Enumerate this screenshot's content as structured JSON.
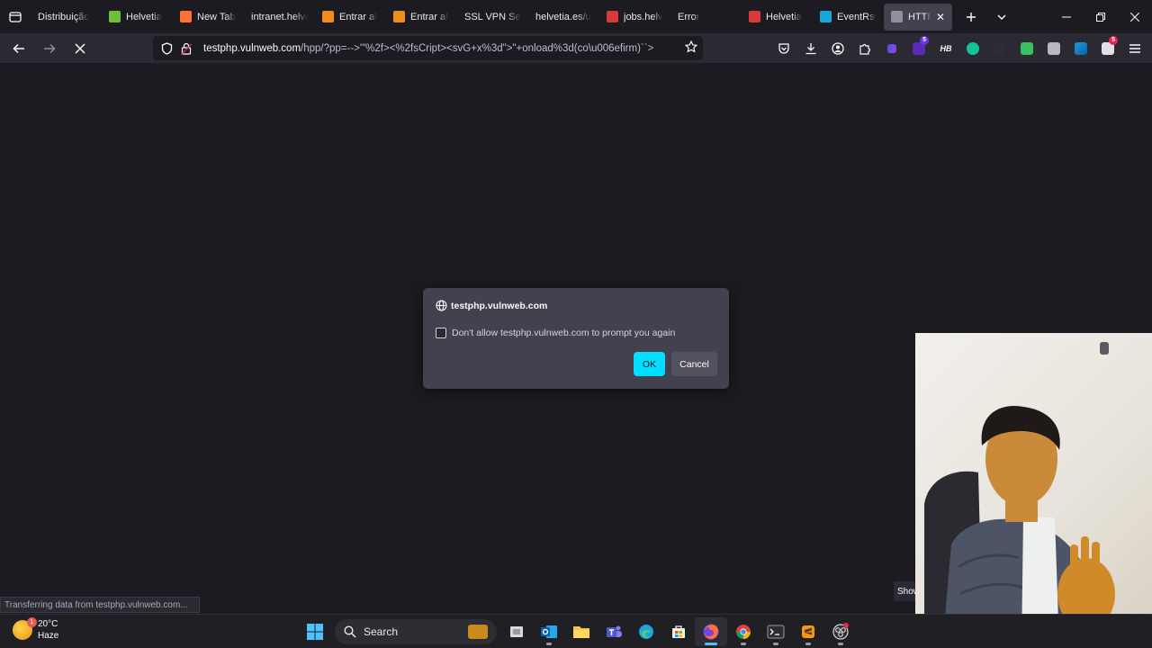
{
  "tabs": [
    {
      "label": "Distribuição",
      "color": "#1c1b22"
    },
    {
      "label": "Helvetia",
      "color": "#6bbf3a"
    },
    {
      "label": "New Tab",
      "color": "#ff7139"
    },
    {
      "label": "intranet.helve",
      "color": "#1c1b22"
    },
    {
      "label": "Entrar al",
      "color": "#f08c1b"
    },
    {
      "label": "Entrar al",
      "color": "#f08c1b"
    },
    {
      "label": "SSL VPN Serv",
      "color": "#1c1b22"
    },
    {
      "label": "helvetia.es/u",
      "color": "#1c1b22"
    },
    {
      "label": "jobs.helv",
      "color": "#d63a3a"
    },
    {
      "label": "Error",
      "color": "#1c1b22"
    },
    {
      "label": "Helvetia",
      "color": "#d63a3a"
    },
    {
      "label": "EventRsv",
      "color": "#1ba6d8"
    },
    {
      "label": "HTTP",
      "color": "#8f8f9d",
      "active": true
    }
  ],
  "urlbar": {
    "host": "testphp.vulnweb.com",
    "path": "/hpp/?pp=-->'\"%2f><%2fsCript><svG+x%3d\">\"+onload%3d(co\\u006efirm)``>"
  },
  "dialog": {
    "origin": "testphp.vulnweb.com",
    "checkbox_label": "Don't allow testphp.vulnweb.com to prompt you again",
    "ok_label": "OK",
    "cancel_label": "Cancel"
  },
  "status": "Transferring data from testphp.vulnweb.com...",
  "show_label": "Show",
  "extensions": {
    "badge_purple": "5",
    "badge_red": "5"
  },
  "taskbar": {
    "weather_temp": "20°C",
    "weather_cond": "Haze",
    "weather_badge": "1",
    "search_label": "Search"
  }
}
